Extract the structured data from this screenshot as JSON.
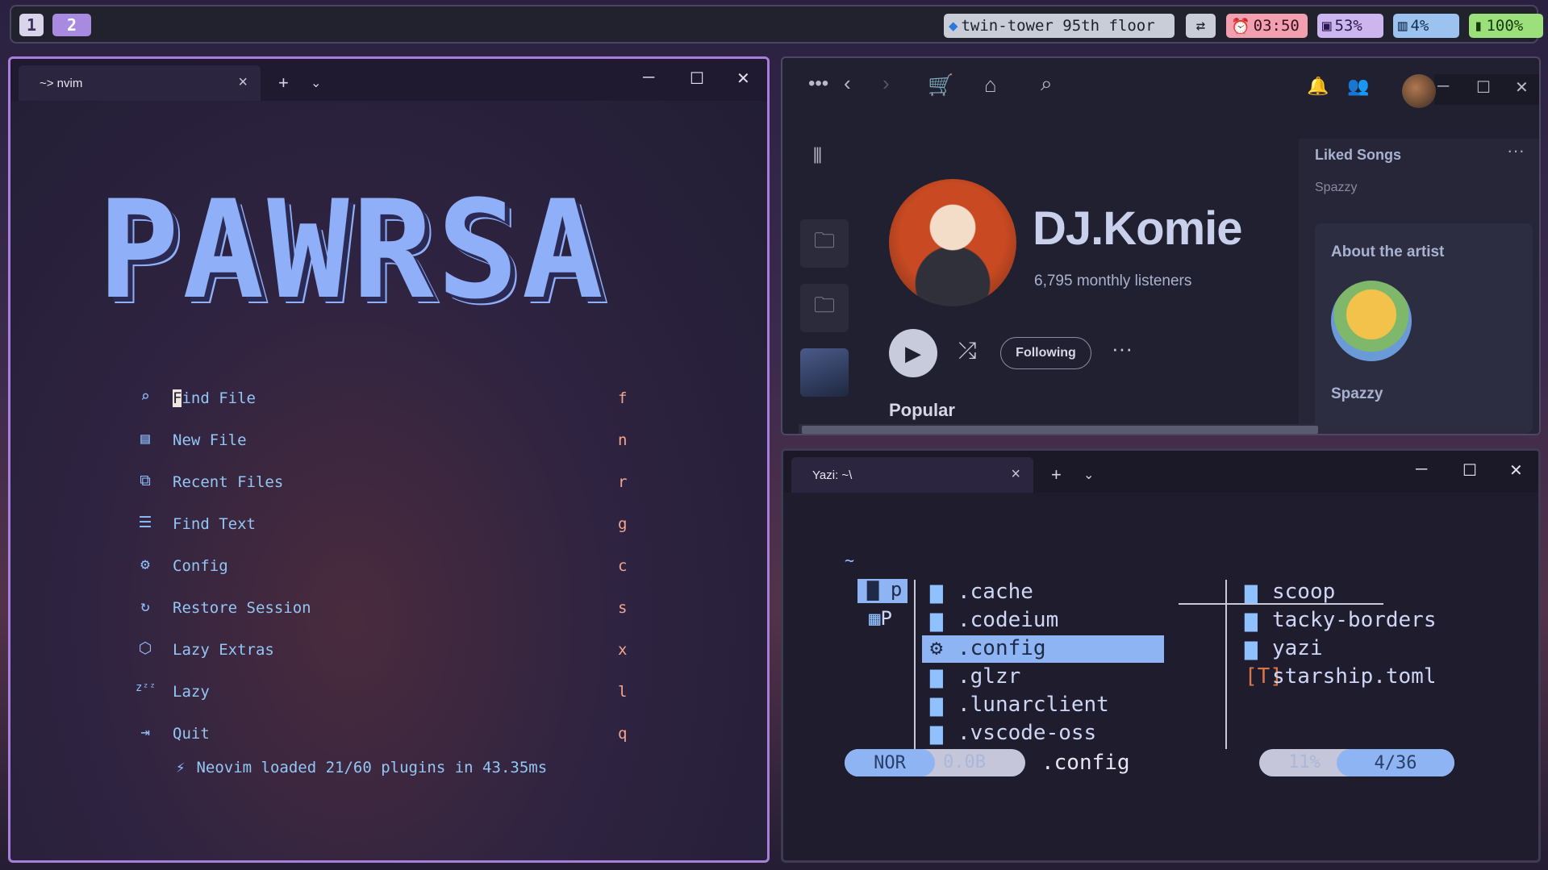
{
  "topbar": {
    "workspaces": [
      "1",
      "2"
    ],
    "location": "twin-tower 95th floor",
    "swap_icon": "⇄",
    "time": "03:50",
    "memory": "53%",
    "cpu": "4%",
    "battery": "100%"
  },
  "nvim": {
    "tab_title": "~> nvim",
    "logo": "PAWRSA",
    "menu": [
      {
        "icon": "search-icon",
        "label": "Find File",
        "key": "f"
      },
      {
        "icon": "file-icon",
        "label": "New File",
        "key": "n"
      },
      {
        "icon": "copy-icon",
        "label": "Recent Files",
        "key": "r"
      },
      {
        "icon": "text-search-icon",
        "label": "Find Text",
        "key": "g"
      },
      {
        "icon": "gear-icon",
        "label": "Config",
        "key": "c"
      },
      {
        "icon": "restore-icon",
        "label": "Restore Session",
        "key": "s"
      },
      {
        "icon": "package-icon",
        "label": "Lazy Extras",
        "key": "x"
      },
      {
        "icon": "sleep-icon",
        "label": "Lazy",
        "key": "l"
      },
      {
        "icon": "exit-icon",
        "label": "Quit",
        "key": "q"
      }
    ],
    "cursor_char": "F",
    "find_file_rest": "ind File",
    "footer": "Neovim loaded 21/60 plugins in 43.35ms"
  },
  "spotify": {
    "artist": "DJ.Komie",
    "listeners": "6,795 monthly listeners",
    "following": "Following",
    "popular": "Popular",
    "liked_songs": "Liked Songs",
    "spazzy_top": "Spazzy",
    "about_title": "About the artist",
    "about_name": "Spazzy"
  },
  "yazi": {
    "tab_title": "Yazi: ~\\",
    "cwd": "~",
    "parent_items": [
      "p",
      "P"
    ],
    "current_items": [
      ".cache",
      ".codeium",
      ".config",
      ".glzr",
      ".lunarclient",
      ".vscode-oss"
    ],
    "selected": ".config",
    "preview_items": [
      {
        "icon": "folder",
        "name": "scoop"
      },
      {
        "icon": "folder",
        "name": "tacky-borders"
      },
      {
        "icon": "folder",
        "name": "yazi"
      },
      {
        "icon": "toml",
        "name": "starship.toml"
      }
    ],
    "mode": "NOR",
    "size": "0.0B",
    "current": ".config",
    "percent": "11%",
    "position": "4/36"
  }
}
